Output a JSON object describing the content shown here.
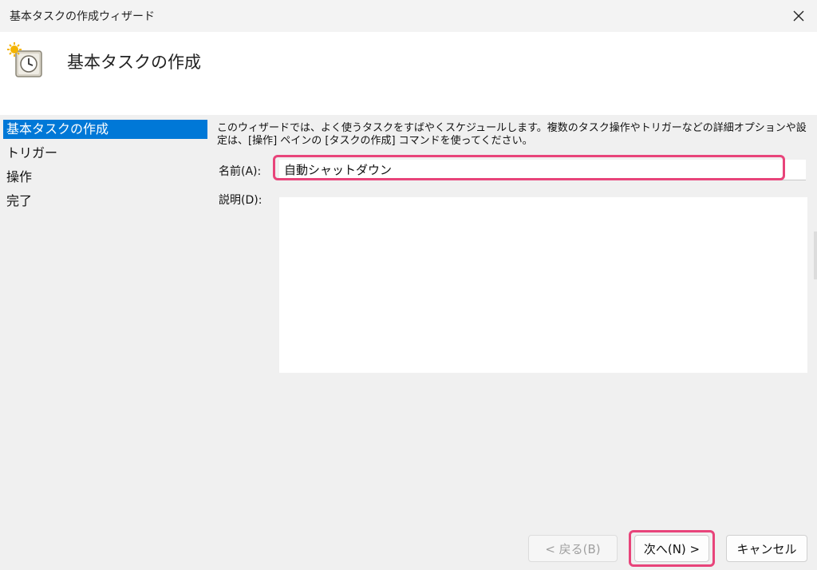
{
  "window": {
    "title": "基本タスクの作成ウィザード",
    "close_icon": "close-icon"
  },
  "header": {
    "icon": "task-clock-icon",
    "heading": "基本タスクの作成"
  },
  "sidebar": {
    "items": [
      {
        "label": "基本タスクの作成",
        "active": true
      },
      {
        "label": "トリガー",
        "active": false
      },
      {
        "label": "操作",
        "active": false
      },
      {
        "label": "完了",
        "active": false
      }
    ]
  },
  "main": {
    "description": "このウィザードでは、よく使うタスクをすばやくスケジュールします。複数のタスク操作やトリガーなどの詳細オプションや設定は、[操作] ペインの [タスクの作成] コマンドを使ってください。",
    "name_label": "名前(A):",
    "name_value": "自動シャットダウン",
    "desc_label": "説明(D):",
    "desc_value": ""
  },
  "buttons": {
    "back": "< 戻る(B)",
    "next": "次へ(N) >",
    "cancel": "キャンセル"
  },
  "colors": {
    "accent": "#0078d7",
    "highlight": "#e8447a"
  }
}
